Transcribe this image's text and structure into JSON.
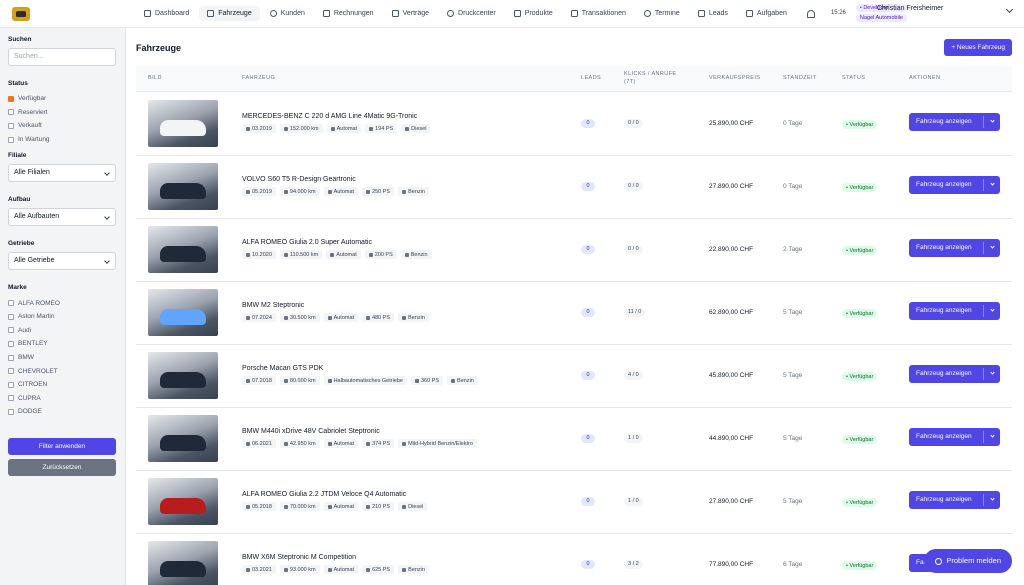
{
  "nav": {
    "items": [
      {
        "label": "Dashboard",
        "name": "nav-dashboard",
        "active": false
      },
      {
        "label": "Fahrzeuge",
        "name": "nav-fahrzeuge",
        "active": true
      },
      {
        "label": "Kunden",
        "name": "nav-kunden",
        "active": false
      },
      {
        "label": "Rechnungen",
        "name": "nav-rechnungen",
        "active": false
      },
      {
        "label": "Verträge",
        "name": "nav-vertraege",
        "active": false
      },
      {
        "label": "Druckcenter",
        "name": "nav-druckcenter",
        "active": false
      },
      {
        "label": "Produkte",
        "name": "nav-produkte",
        "active": false
      },
      {
        "label": "Transaktionen",
        "name": "nav-transaktionen",
        "active": false
      },
      {
        "label": "Termine",
        "name": "nav-termine",
        "active": false
      },
      {
        "label": "Leads",
        "name": "nav-leads",
        "active": false
      },
      {
        "label": "Aufgaben",
        "name": "nav-aufgaben",
        "active": false
      }
    ]
  },
  "user": {
    "time": "15:26",
    "role_badge": "• Developer",
    "name": "Christian Freisheimer",
    "dealer_badge": "Nagel Automobile"
  },
  "sidebar": {
    "search_label": "Suchen",
    "search_placeholder": "Suchen...",
    "status_label": "Status",
    "status_options": [
      {
        "label": "Verfügbar",
        "checked": true
      },
      {
        "label": "Reserviert",
        "checked": false
      },
      {
        "label": "Verkauft",
        "checked": false
      },
      {
        "label": "In Wartung",
        "checked": false
      }
    ],
    "filiale_label": "Filiale",
    "filiale_value": "Alle Filialen",
    "aufbau_label": "Aufbau",
    "aufbau_value": "Alle Aufbauten",
    "getriebe_label": "Getriebe",
    "getriebe_value": "Alle Getriebe",
    "marke_label": "Marke",
    "marken": [
      "ALFA ROMEO",
      "Aston Martin",
      "Audi",
      "BENTLEY",
      "BMW",
      "CHEVROLET",
      "CITROEN",
      "CUPRA",
      "DODGE"
    ],
    "apply_label": "Filter anwenden",
    "reset_label": "Zurücksetzen"
  },
  "main": {
    "title": "Fahrzeuge",
    "new_button": "+ Neues Fahrzeug",
    "columns": [
      "Bild",
      "Fahrzeug",
      "Leads",
      "Klicks / Anrufe (7T)",
      "Verkaufspreis",
      "Standzeit",
      "Status",
      "Aktionen"
    ],
    "action_label": "Fahrzeug anzeigen",
    "rows": [
      {
        "model": "MERCEDES-BENZ C 220 d AMG Line 4Matic 9G-Tronic",
        "date": "03.2019",
        "km": "152.000 km",
        "gear": "Automat",
        "ps": "194 PS",
        "fuel": "Diesel",
        "leads": "0",
        "clicks": "0 / 0",
        "price": "25.890,00 CHF",
        "days": "0 Tage",
        "status": "• Verfügbar",
        "car": "light"
      },
      {
        "model": "VOLVO S60 T5 R-Design Geartronic",
        "date": "05.2019",
        "km": "94.000 km",
        "gear": "Automat",
        "ps": "250 PS",
        "fuel": "Benzin",
        "leads": "0",
        "clicks": "0 / 0",
        "price": "27.890,00 CHF",
        "days": "0 Tage",
        "status": "• Verfügbar",
        "car": "dark"
      },
      {
        "model": "ALFA ROMEO Giulia 2.0 Super Automatic",
        "date": "10.2020",
        "km": "110.500 km",
        "gear": "Automat",
        "ps": "200 PS",
        "fuel": "Benzin",
        "leads": "0",
        "clicks": "0 / 0",
        "price": "22.890,00 CHF",
        "days": "2 Tage",
        "status": "• Verfügbar",
        "car": "dark"
      },
      {
        "model": "BMW M2 Steptronic",
        "date": "07.2024",
        "km": "30.500 km",
        "gear": "Automat",
        "ps": "480 PS",
        "fuel": "Benzin",
        "leads": "0",
        "clicks": "11 / 0",
        "price": "62.890,00 CHF",
        "days": "5 Tage",
        "status": "• Verfügbar",
        "car": "blue"
      },
      {
        "model": "Porsche Macan GTS PDK",
        "date": "07.2018",
        "km": "80.000 km",
        "gear": "Halbautomatisches Getriebe",
        "ps": "360 PS",
        "fuel": "Benzin",
        "leads": "0",
        "clicks": "4 / 0",
        "price": "45.890,00 CHF",
        "days": "5 Tage",
        "status": "• Verfügbar",
        "car": "dark"
      },
      {
        "model": "BMW M440i xDrive 48V Cabriolet Steptronic",
        "date": "06.2021",
        "km": "42.950 km",
        "gear": "Automat",
        "ps": "374 PS",
        "fuel": "Mild-Hybrid Benzin/Elektro",
        "leads": "0",
        "clicks": "1 / 0",
        "price": "44.890,00 CHF",
        "days": "5 Tage",
        "status": "• Verfügbar",
        "car": "dark"
      },
      {
        "model": "ALFA ROMEO Giulia 2.2 JTDM Veloce Q4 Automatic",
        "date": "05.2018",
        "km": "70.000 km",
        "gear": "Automat",
        "ps": "210 PS",
        "fuel": "Diesel",
        "leads": "0",
        "clicks": "1 / 0",
        "price": "27.890,00 CHF",
        "days": "5 Tage",
        "status": "• Verfügbar",
        "car": "red"
      },
      {
        "model": "BMW X6M Steptronic M Competition",
        "date": "03.2021",
        "km": "93.000 km",
        "gear": "Automat",
        "ps": "625 PS",
        "fuel": "Benzin",
        "leads": "0",
        "clicks": "3 / 2",
        "price": "77.890,00 CHF",
        "days": "6 Tage",
        "status": "• Verfügbar",
        "car": "dark"
      }
    ]
  },
  "help": {
    "label": "Problem melden"
  }
}
